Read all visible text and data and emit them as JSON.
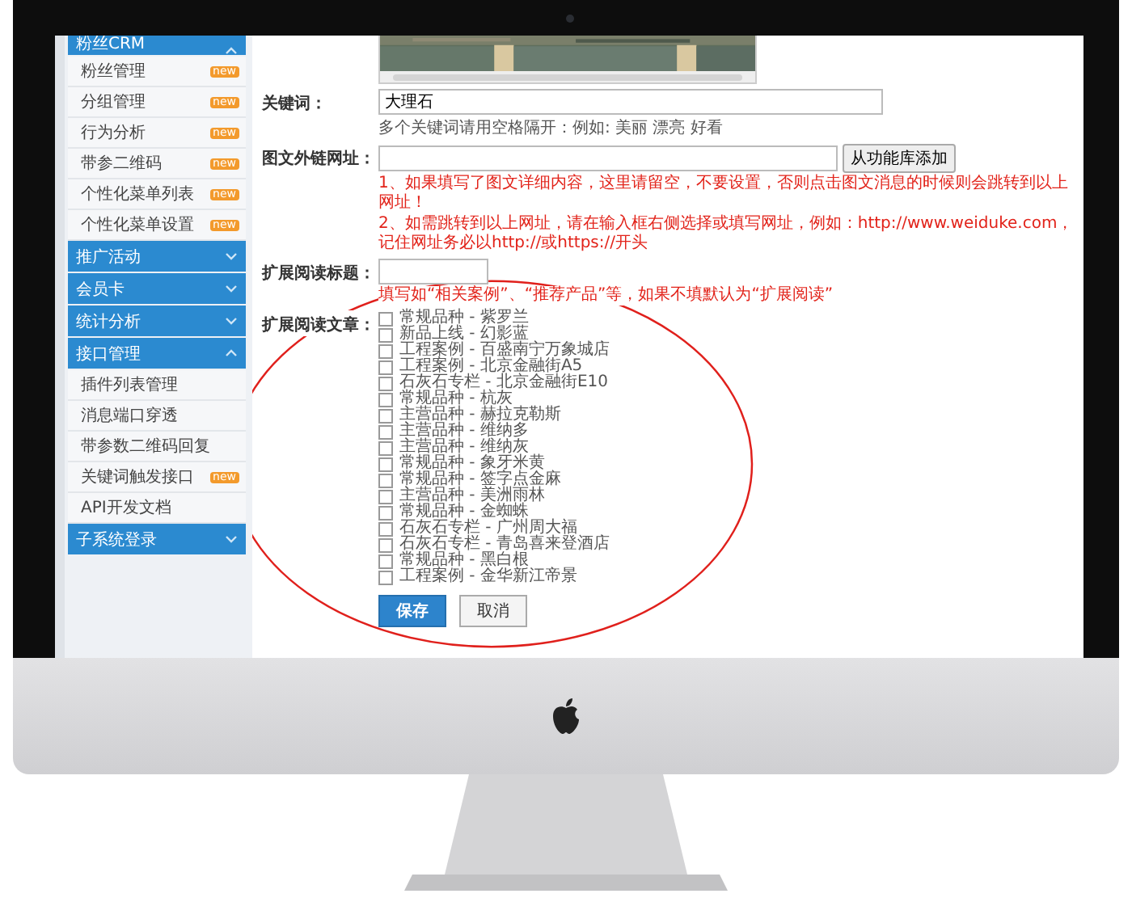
{
  "sidebar": {
    "sections": [
      {
        "title": "粉丝CRM",
        "expanded": true,
        "items": [
          {
            "label": "粉丝管理",
            "badge": "new"
          },
          {
            "label": "分组管理",
            "badge": "new"
          },
          {
            "label": "行为分析",
            "badge": "new"
          },
          {
            "label": "带参二维码",
            "badge": "new"
          },
          {
            "label": "个性化菜单列表",
            "badge": "new"
          },
          {
            "label": "个性化菜单设置",
            "badge": "new"
          }
        ]
      },
      {
        "title": "推广活动",
        "expanded": false
      },
      {
        "title": "会员卡",
        "expanded": false
      },
      {
        "title": "统计分析",
        "expanded": false
      },
      {
        "title": "接口管理",
        "expanded": true,
        "items": [
          {
            "label": "插件列表管理"
          },
          {
            "label": "消息端口穿透"
          },
          {
            "label": "带参数二维码回复"
          },
          {
            "label": "关键词触发接口",
            "badge": "new"
          },
          {
            "label": "API开发文档"
          }
        ]
      },
      {
        "title": "子系统登录",
        "expanded": false
      }
    ]
  },
  "form": {
    "keywords": {
      "label": "关键词：",
      "value": "大理石",
      "hint": "多个关键词请用空格隔开：例如: 美丽 漂亮 好看"
    },
    "link": {
      "label": "图文外链网址：",
      "button": "从功能库添加",
      "notes": [
        "1、如果填写了图文详细内容，这里请留空，不要设置，否则点击图文消息的时候则会跳转到以上网址！",
        "2、如需跳转到以上网址，请在输入框右侧选择或填写网址，例如：http://www.weiduke.com，记住网址务必以http://或https://开头"
      ]
    },
    "read_title": {
      "label": "扩展阅读标题：",
      "note": "填写如“相关案例”、“推荐产品”等，如果不填默认为“扩展阅读”"
    },
    "articles": {
      "label": "扩展阅读文章：",
      "items": [
        {
          "label": "常规品种 - 紫罗兰",
          "checked": false
        },
        {
          "label": "新品上线 - 幻影蓝",
          "checked": false
        },
        {
          "label": "工程案例 - 百盛南宁万象城店",
          "checked": false
        },
        {
          "label": "工程案例 - 北京金融街A5",
          "checked": false
        },
        {
          "label": "石灰石专栏 - 北京金融街E10",
          "checked": false
        },
        {
          "label": "常规品种 - 杭灰",
          "checked": false
        },
        {
          "label": "主营品种 - 赫拉克勒斯",
          "checked": false
        },
        {
          "label": "主营品种 - 维纳多",
          "checked": false
        },
        {
          "label": "主营品种 - 维纳灰",
          "checked": false
        },
        {
          "label": "常规品种 - 象牙米黄",
          "checked": false
        },
        {
          "label": "常规品种 - 签字点金麻",
          "checked": false
        },
        {
          "label": "主营品种 - 美洲雨林",
          "checked": false
        },
        {
          "label": "常规品种 - 金蜘蛛",
          "checked": false
        },
        {
          "label": "石灰石专栏 - 广州周大福",
          "checked": false
        },
        {
          "label": "石灰石专栏 - 青岛喜来登酒店",
          "checked": false
        },
        {
          "label": "常规品种 - 黑白根",
          "checked": false
        },
        {
          "label": "工程案例 - 金华新江帝景",
          "checked": false
        }
      ]
    },
    "buttons": [
      {
        "label": "保存",
        "kind": "primary"
      },
      {
        "label": "取消",
        "kind": "default"
      }
    ]
  }
}
